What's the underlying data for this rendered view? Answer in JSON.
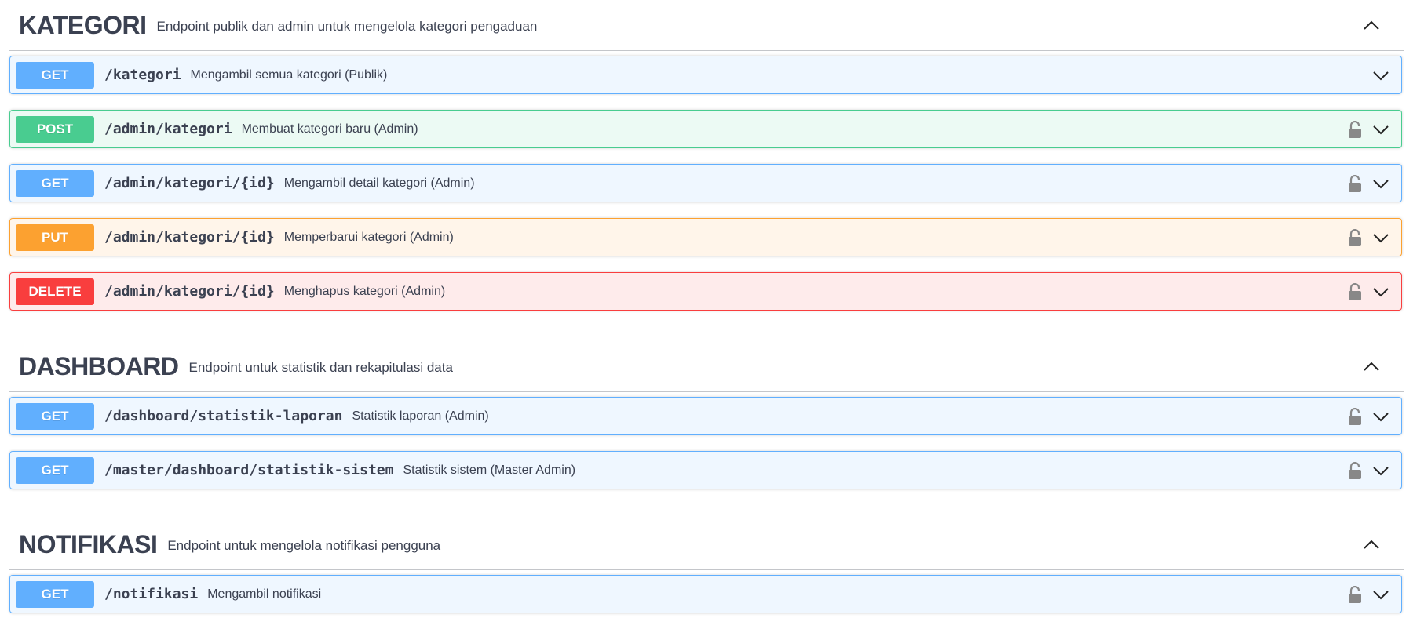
{
  "colors": {
    "get": "#61affe",
    "post": "#49cc90",
    "put": "#fca130",
    "delete": "#f93e3e",
    "text": "#3b4151",
    "lock": "#888888"
  },
  "sections": [
    {
      "title": "KATEGORI",
      "description": "Endpoint publik dan admin untuk mengelola kategori pengaduan",
      "toggle_icon": "chevron-up-icon",
      "operations": [
        {
          "method": "GET",
          "path": "/kategori",
          "summary": "Mengambil semua kategori (Publik)",
          "locked": false
        },
        {
          "method": "POST",
          "path": "/admin/kategori",
          "summary": "Membuat kategori baru (Admin)",
          "locked": true
        },
        {
          "method": "GET",
          "path": "/admin/kategori/{id}",
          "summary": "Mengambil detail kategori (Admin)",
          "locked": true
        },
        {
          "method": "PUT",
          "path": "/admin/kategori/{id}",
          "summary": "Memperbarui kategori (Admin)",
          "locked": true
        },
        {
          "method": "DELETE",
          "path": "/admin/kategori/{id}",
          "summary": "Menghapus kategori (Admin)",
          "locked": true
        }
      ]
    },
    {
      "title": "DASHBOARD",
      "description": "Endpoint untuk statistik dan rekapitulasi data",
      "toggle_icon": "chevron-up-icon",
      "operations": [
        {
          "method": "GET",
          "path": "/dashboard/statistik-laporan",
          "summary": "Statistik laporan (Admin)",
          "locked": true
        },
        {
          "method": "GET",
          "path": "/master/dashboard/statistik-sistem",
          "summary": "Statistik sistem (Master Admin)",
          "locked": true
        }
      ]
    },
    {
      "title": "NOTIFIKASI",
      "description": "Endpoint untuk mengelola notifikasi pengguna",
      "toggle_icon": "chevron-up-icon",
      "operations": [
        {
          "method": "GET",
          "path": "/notifikasi",
          "summary": "Mengambil notifikasi",
          "locked": true
        }
      ]
    }
  ]
}
